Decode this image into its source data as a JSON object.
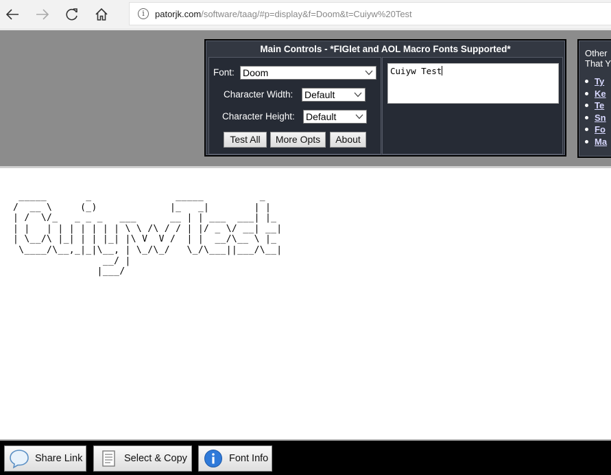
{
  "browser": {
    "url_host": "patorjk.com",
    "url_path": "/software/taag/#p=display&f=Doom&t=Cuiyw%20Test",
    "icons": [
      "back-icon",
      "forward-icon",
      "refresh-icon",
      "home-icon",
      "info-icon"
    ]
  },
  "main_controls": {
    "title": "Main Controls - *FIGlet and AOL Macro Fonts Supported*",
    "font_label": "Font:",
    "font_value": "Doom",
    "width_label": "Character Width:",
    "width_value": "Default",
    "height_label": "Character Height:",
    "height_value": "Default",
    "buttons": {
      "test_all": "Test All",
      "more_opts": "More Opts",
      "about": "About"
    },
    "input_text": "Cuiyw Test"
  },
  "side_panel": {
    "heading_line1": "Other",
    "heading_line2": "That Y",
    "links": [
      "Ty",
      "Ke",
      "Te",
      "Sn",
      "Fo",
      "Ma"
    ]
  },
  "output": {
    "ascii_art": " _____       _               _____          _   \n/  __ \\     (_)             |_   _|        | |  \n| /  \\/_   _ _ _   ___      __ | | ___  ___| |_ \n| |   | | | | | | | \\ \\ /\\ / / | |/ _ \\/ __| __|\n| \\__/\\ |_| | | |_| |\\ V  V /  | |  __/\\__ \\ |_ \n \\____/\\__,_|_|\\__, | \\_/\\_/   \\_/\\___||___/\\__|\n                __/ |                          \n               |___/                           "
  },
  "toolbar": {
    "share_link": "Share Link",
    "select_copy": "Select & Copy",
    "font_info": "Font Info"
  },
  "colors": {
    "gray_band": "#8c8c8c",
    "panel_bg": "#333842",
    "panel_box": "#262b35",
    "toolbar_bg": "#000000"
  }
}
